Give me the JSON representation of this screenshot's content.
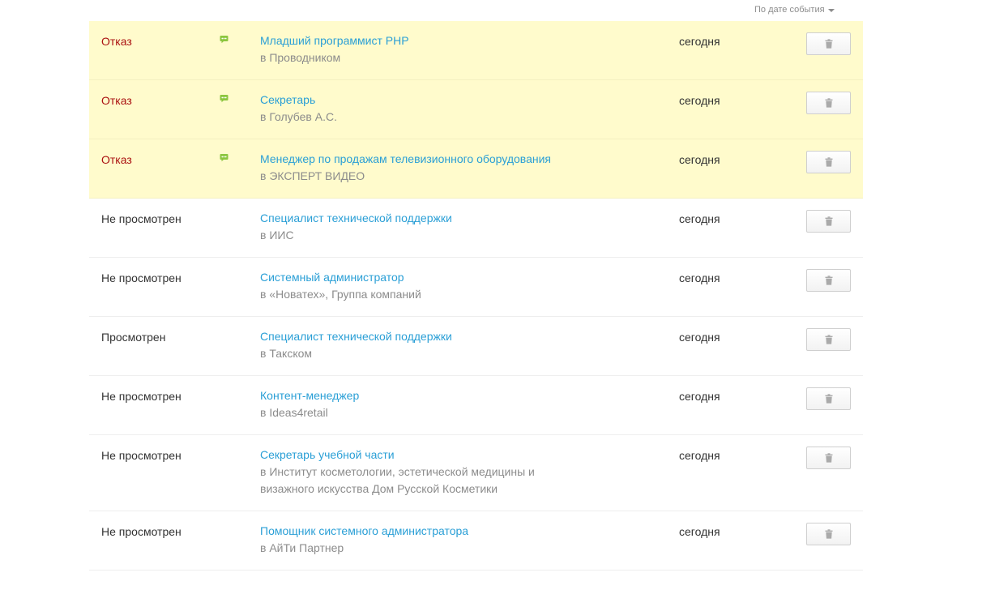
{
  "sort": {
    "label": "По дате события"
  },
  "colors": {
    "rejected_bg": "#fffbcc",
    "rejected_text": "#aa1010",
    "link": "#2a9fd6",
    "message_icon": "#8cc63f"
  },
  "icons": {
    "message": "speech-bubble-icon",
    "delete": "trash-icon",
    "sort": "caret-down-icon"
  },
  "responses": [
    {
      "status": "Отказ",
      "rejected": true,
      "has_message": true,
      "vacancy": "Младший программист PHP",
      "company": "в Проводником",
      "date": "сегодня"
    },
    {
      "status": "Отказ",
      "rejected": true,
      "has_message": true,
      "vacancy": "Секретарь",
      "company": "в Голубев А.С.",
      "date": "сегодня"
    },
    {
      "status": "Отказ",
      "rejected": true,
      "has_message": true,
      "vacancy": "Менеджер по продажам телевизионного оборудования",
      "company": "в ЭКСПЕРТ ВИДЕО",
      "date": "сегодня"
    },
    {
      "status": "Не просмотрен",
      "rejected": false,
      "has_message": false,
      "vacancy": "Специалист технической поддержки",
      "company": "в ИИС",
      "date": "сегодня"
    },
    {
      "status": "Не просмотрен",
      "rejected": false,
      "has_message": false,
      "vacancy": "Системный администратор",
      "company": "в «Новатех», Группа компаний",
      "date": "сегодня"
    },
    {
      "status": "Просмотрен",
      "rejected": false,
      "has_message": false,
      "vacancy": "Специалист технической поддержки",
      "company": "в Такском",
      "date": "сегодня"
    },
    {
      "status": "Не просмотрен",
      "rejected": false,
      "has_message": false,
      "vacancy": "Контент-менеджер",
      "company": "в Ideas4retail",
      "date": "сегодня"
    },
    {
      "status": "Не просмотрен",
      "rejected": false,
      "has_message": false,
      "vacancy": "Секретарь учебной части",
      "company": "в Институт косметологии, эстетической медицины и визажного искусства Дом Русской Косметики",
      "date": "сегодня"
    },
    {
      "status": "Не просмотрен",
      "rejected": false,
      "has_message": false,
      "vacancy": "Помощник системного администратора",
      "company": "в АйТи Партнер",
      "date": "сегодня"
    }
  ]
}
